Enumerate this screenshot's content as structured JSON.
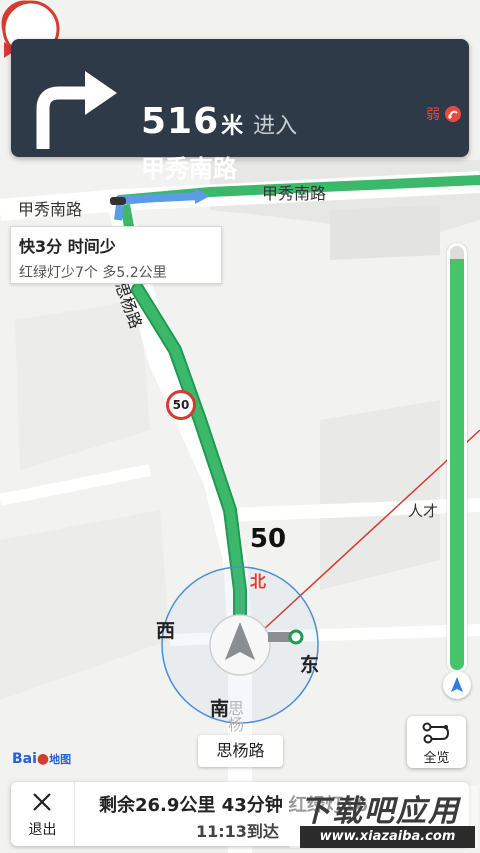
{
  "instruction": {
    "distance": "516",
    "unit": "米",
    "action": "进入",
    "road": "甲秀南路",
    "signal_text": "弱",
    "turn_icon": "turn-right-arrow-icon"
  },
  "alt_route": {
    "title": "快3分 时间少",
    "subtitle": "红绿灯少7个 多5.2公里"
  },
  "map": {
    "road_top_left": "甲秀南路",
    "road_top_right": "甲秀南路",
    "road_vertical": "思杨路",
    "poi_label": "人才",
    "speed_limit_small": "50",
    "speed_limit_big": "50",
    "compass": {
      "north": "北",
      "west": "西",
      "east": "东",
      "south": "南"
    },
    "current_road": "思杨路",
    "current_road_faint": "思杨"
  },
  "route_progress": 0.97,
  "overview": {
    "label": "全览",
    "icon": "route-overview-icon"
  },
  "logo": {
    "text": "Bai",
    "mark": "地图"
  },
  "bottom": {
    "exit_label": "退出",
    "remaining": "剩余26.9公里 43分钟 红绿灯16",
    "arrival": "11:13到达"
  },
  "watermark": {
    "title": "下载吧应用",
    "url": "www.xiazaiba.com"
  },
  "colors": {
    "card_bg": "#2f3a48",
    "route_green": "#3cb86a",
    "alt_blue": "#5b9be8",
    "warn_red": "#d63b2f"
  }
}
